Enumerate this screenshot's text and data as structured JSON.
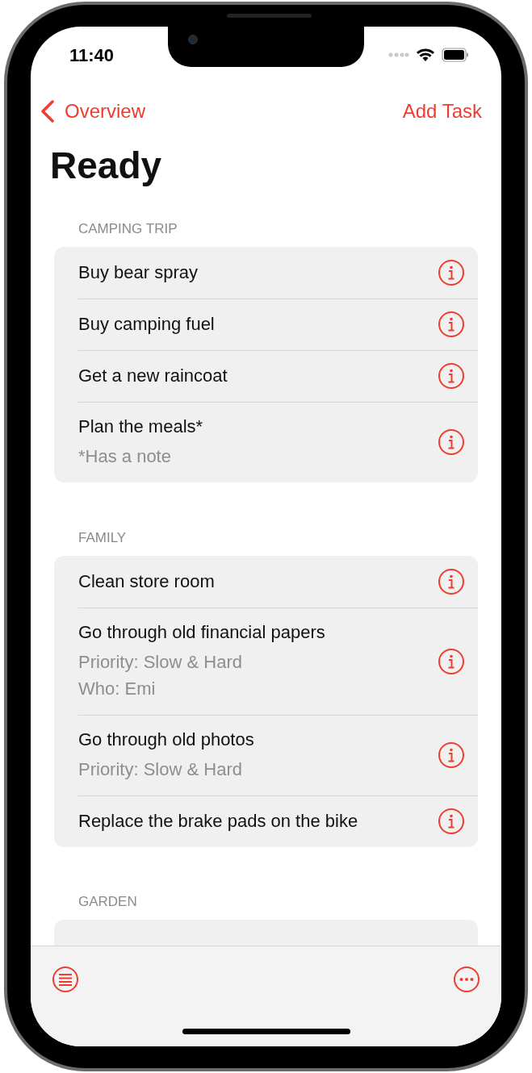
{
  "status_bar": {
    "time": "11:40"
  },
  "nav": {
    "back_label": "Overview",
    "action_label": "Add Task"
  },
  "title": "Ready",
  "sections": [
    {
      "header": "CAMPING TRIP",
      "items": [
        {
          "title": "Buy bear spray"
        },
        {
          "title": "Buy camping fuel"
        },
        {
          "title": "Get a new raincoat"
        },
        {
          "title": "Plan the meals*",
          "details": [
            "*Has a note"
          ]
        }
      ]
    },
    {
      "header": "FAMILY",
      "items": [
        {
          "title": "Clean store room"
        },
        {
          "title": "Go through old financial papers",
          "details": [
            "Priority: Slow & Hard",
            "Who: Emi"
          ]
        },
        {
          "title": "Go through old photos",
          "details": [
            "Priority: Slow & Hard"
          ]
        },
        {
          "title": "Replace the brake pads on the bike"
        }
      ]
    },
    {
      "header": "GARDEN"
    }
  ]
}
